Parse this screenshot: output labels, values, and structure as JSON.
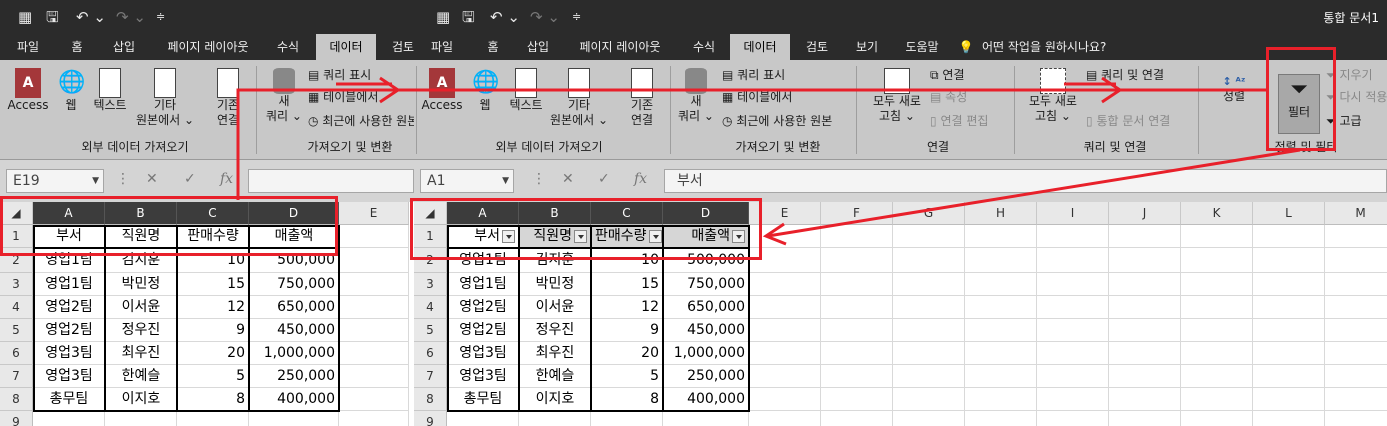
{
  "qat": {
    "doc_title": "통합 문서1"
  },
  "tabs_left": [
    "파일",
    "홈",
    "삽입",
    "페이지 레이아웃",
    "수식",
    "데이터",
    "검토"
  ],
  "tabs_right": [
    "파일",
    "홈",
    "삽입",
    "페이지 레이아웃",
    "수식",
    "데이터",
    "검토",
    "보기",
    "도움말"
  ],
  "tell_me": "어떤 작업을 원하시나요?",
  "ribbon": {
    "access": "Access",
    "web": "웹",
    "text": "텍스트",
    "other1": "기타",
    "other2": "원본에서 ⌄",
    "existing1": "기존",
    "existing2": "연결",
    "new1": "새",
    "new2": "쿼리 ⌄",
    "query_show": "쿼리 표시",
    "from_table": "테이블에서",
    "recent": "최근에 사용한 원본",
    "group_ext": "외부 데이터 가져오기",
    "group_get": "가져오기 및 변환",
    "refresh1": "모두 새로",
    "refresh2": "고침 ⌄",
    "conn": "연결",
    "props": "속성",
    "edit_links": "연결 편집",
    "group_conn": "연결",
    "query_conn": "쿼리 및 연결",
    "wb_links": "통합 문서 연결",
    "group_qc": "쿼리 및 연결",
    "sort": "정렬",
    "filter": "필터",
    "clear": "지우기",
    "reapply": "다시 적용",
    "advanced": "고급",
    "group_sort": "정렬 및 필터"
  },
  "formula_left": {
    "name_box": "E19",
    "formula": ""
  },
  "formula_right": {
    "name_box": "A1",
    "formula": "부서"
  },
  "columns_left": [
    "A",
    "B",
    "C",
    "D",
    "E"
  ],
  "columns_right": [
    "A",
    "B",
    "C",
    "D",
    "E",
    "F",
    "G",
    "H",
    "I",
    "J",
    "K",
    "L",
    "M"
  ],
  "rows": [
    "1",
    "2",
    "3",
    "4",
    "5",
    "6",
    "7",
    "8",
    "9"
  ],
  "headers": [
    "부서",
    "직원명",
    "판매수량",
    "매출액"
  ],
  "data": [
    [
      "영업1팀",
      "김지훈",
      "10",
      "500,000"
    ],
    [
      "영업1팀",
      "박민정",
      "15",
      "750,000"
    ],
    [
      "영업2팀",
      "이서윤",
      "12",
      "650,000"
    ],
    [
      "영업2팀",
      "정우진",
      "9",
      "450,000"
    ],
    [
      "영업3팀",
      "최우진",
      "20",
      "1,000,000"
    ],
    [
      "영업3팀",
      "한예슬",
      "5",
      "250,000"
    ],
    [
      "총무팀",
      "이지호",
      "8",
      "400,000"
    ]
  ],
  "colors": {
    "accent": "#e8202a",
    "dark": "#2b2b2b"
  }
}
